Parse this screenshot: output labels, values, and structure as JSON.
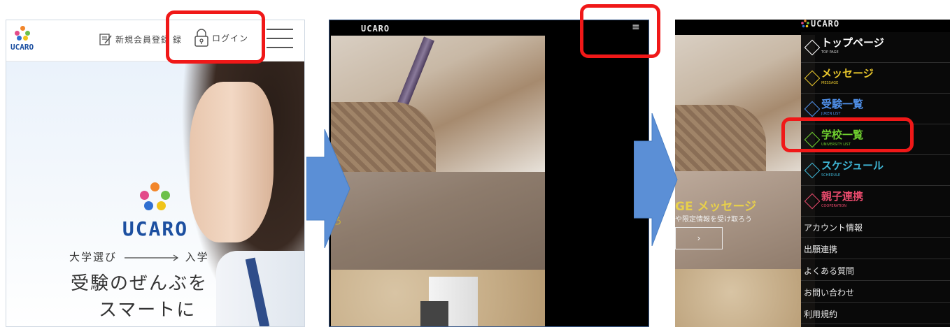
{
  "panel1": {
    "header": {
      "logo_text": "UCARO",
      "register_label": "新規会員登録",
      "login_label": "ログイン"
    },
    "hero": {
      "logo_text": "UCARO",
      "tagline_from": "大学選び",
      "tagline_to": "入学",
      "headline_1": "受験のぜんぶを",
      "headline_2": "スマートに"
    }
  },
  "panel2": {
    "header": {
      "logo_text": "UCARO",
      "menu_glyph": "≡"
    },
    "partial_text": "ろ"
  },
  "panel3": {
    "drawer": {
      "logo_text": "UCARO",
      "items": [
        {
          "label": "トップページ",
          "sub": "TOP PAGE",
          "color": "#ffffff",
          "subcolor": "#cccccc"
        },
        {
          "label": "メッセージ",
          "sub": "MESSAGE",
          "color": "#e8c62c",
          "subcolor": "#e8c62c"
        },
        {
          "label": "受験一覧",
          "sub": "JUKEN LIST",
          "color": "#4f8fe8",
          "subcolor": "#4f8fe8"
        },
        {
          "label": "学校一覧",
          "sub": "UNIVERSITY LIST",
          "color": "#6fcf2f",
          "subcolor": "#6fcf2f"
        },
        {
          "label": "スケジュール",
          "sub": "SCHEDULE",
          "color": "#3fb6d6",
          "subcolor": "#3fb6d6"
        },
        {
          "label": "親子連携",
          "sub": "COOPERATION",
          "color": "#e84a6c",
          "subcolor": "#e84a6c"
        }
      ],
      "plain_items": [
        "アカウント情報",
        "出願連携",
        "よくある質問",
        "お問い合わせ",
        "利用規約"
      ]
    },
    "background": {
      "message_title": "GE メッセージ",
      "message_sub": "や限定情報を受け取ろう",
      "button_glyph": "›"
    }
  },
  "annotations": {
    "highlight_color": "#f01818",
    "arrow_color": "#5b8fd6"
  }
}
